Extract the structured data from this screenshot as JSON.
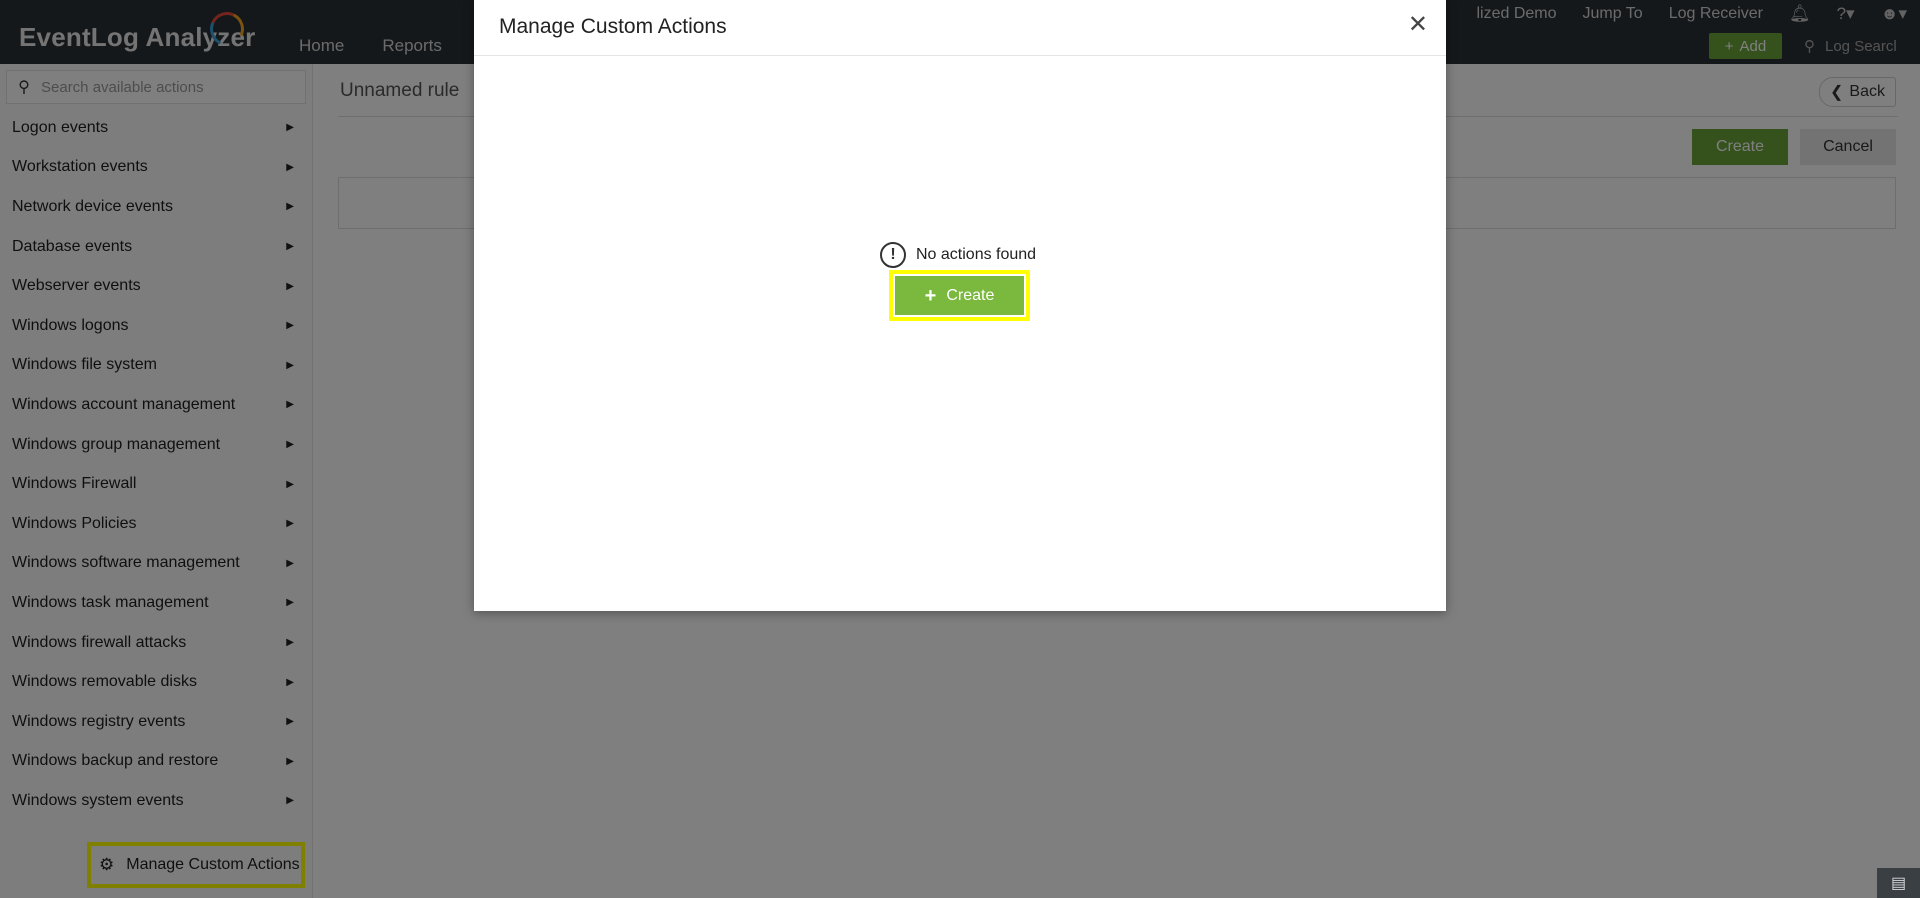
{
  "app": {
    "logo_text": "EventLog Analyzer",
    "nav": [
      "Home",
      "Reports"
    ],
    "top_links": [
      "lized Demo",
      "Jump To",
      "Log Receiver"
    ],
    "add_label": "Add",
    "search_placeholder": "Log Searcl"
  },
  "sidebar": {
    "search_placeholder": "Search available actions",
    "items": [
      "Logon events",
      "Workstation events",
      "Network device events",
      "Database events",
      "Webserver events",
      "Windows logons",
      "Windows file system",
      "Windows account management",
      "Windows group management",
      "Windows Firewall",
      "Windows Policies",
      "Windows software management",
      "Windows task management",
      "Windows firewall attacks",
      "Windows removable disks",
      "Windows registry events",
      "Windows backup and restore",
      "Windows system events"
    ],
    "manage_label": "Manage Custom Actions"
  },
  "main": {
    "rule_title": "Unnamed rule",
    "back_label": "Back",
    "create_label": "Create",
    "cancel_label": "Cancel"
  },
  "modal": {
    "title": "Manage Custom Actions",
    "empty_message": "No actions found",
    "create_label": "Create"
  },
  "colors": {
    "accent_green": "#7ab83e",
    "highlight": "#ffff00",
    "topbar": "#2b3036"
  }
}
